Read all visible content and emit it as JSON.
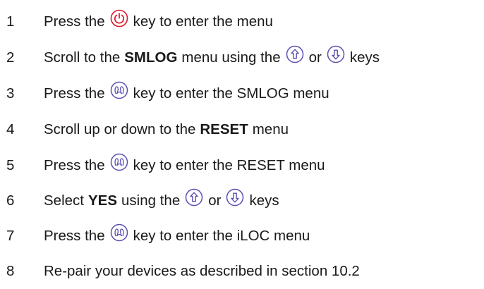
{
  "steps": [
    {
      "n": "1",
      "parts": [
        "Press the",
        "key to enter the menu"
      ]
    },
    {
      "n": "2",
      "parts": [
        "Scroll to the",
        "SMLOG",
        "menu using the",
        "or",
        "keys"
      ]
    },
    {
      "n": "3",
      "parts": [
        "Press the",
        "key to enter the SMLOG menu"
      ]
    },
    {
      "n": "4",
      "parts": [
        "Scroll up or down to the",
        "RESET",
        "menu"
      ]
    },
    {
      "n": "5",
      "parts": [
        "Press the",
        "key to enter the RESET menu"
      ]
    },
    {
      "n": "6",
      "parts": [
        "Select",
        "YES",
        "using the",
        "or",
        "keys"
      ]
    },
    {
      "n": "7",
      "parts": [
        "Press the",
        "key to enter the iLOC menu"
      ]
    },
    {
      "n": "8",
      "parts": [
        "Re-pair your devices as described in section 10.2"
      ]
    }
  ],
  "icons": {
    "power": "power-icon",
    "up": "up-arrow-icon",
    "down": "down-arrow-icon",
    "enter": "enter-key-icon"
  },
  "colors": {
    "power": "#e0152a",
    "arrow": "#5a4fb0",
    "enter": "#5a4fb0"
  }
}
